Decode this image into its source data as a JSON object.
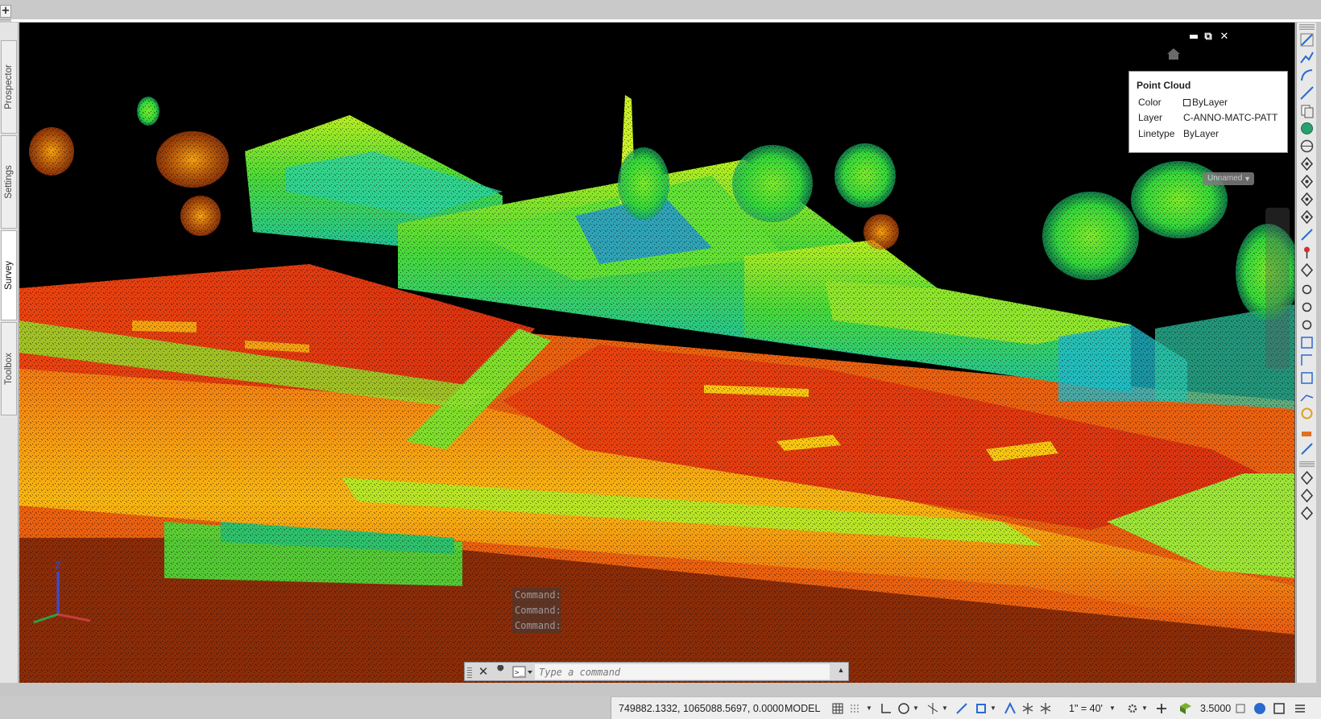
{
  "app": {
    "new_tab_label": "+"
  },
  "left_tabs": [
    {
      "label": "Prospector",
      "active": false
    },
    {
      "label": "Settings",
      "active": false
    },
    {
      "label": "Survey",
      "active": true
    },
    {
      "label": "Toolbox",
      "active": false
    }
  ],
  "viewport": {
    "window_controls": [
      "minimize-icon",
      "restore-icon",
      "close-icon"
    ],
    "home_icon": "home-icon",
    "view_name_chip": "Unnamed",
    "ucs_labels": {
      "z": "Z",
      "y": "Y"
    }
  },
  "properties_tooltip": {
    "title": "Point Cloud",
    "rows": [
      {
        "label": "Color",
        "value": "ByLayer",
        "swatch": "#ffffff"
      },
      {
        "label": "Layer",
        "value": "C-ANNO-MATC-PATT"
      },
      {
        "label": "Linetype",
        "value": "ByLayer"
      }
    ]
  },
  "command_line": {
    "history": [
      "Command:",
      "Command:",
      "Command:"
    ],
    "placeholder": "Type a command",
    "close_label": "✕",
    "expand_label": "▲"
  },
  "status_bar": {
    "coordinates": "749882.1332, 1065088.5697, 0.0000",
    "model_label": "MODEL",
    "scale": "1\" = 40'",
    "annotation_value": "3.5000",
    "icons": [
      "grid-icon",
      "snap-icon",
      "ortho-icon",
      "polar-icon",
      "isodraft-icon",
      "osnap-tracking-icon",
      "osnap-icon",
      "lineweight-icon",
      "transparency-icon",
      "selection-cycling-icon",
      "annotation-visibility-icon",
      "autoscale-icon",
      "annoscale-icon",
      "workspace-gear-icon",
      "plus-icon",
      "units-icon",
      "isolate-icon",
      "fullscreen-icon",
      "customize-menu-icon"
    ]
  },
  "colors": {
    "viewport_bg": "#000000",
    "cloud_ground": "#e83a10",
    "cloud_mid": "#f4c20d",
    "cloud_high": "#56e02a",
    "cloud_top": "#1aa8d8",
    "ucs_z": "#3c4bd8",
    "ucs_x": "#c83c3c",
    "ucs_y": "#2ca04c"
  }
}
